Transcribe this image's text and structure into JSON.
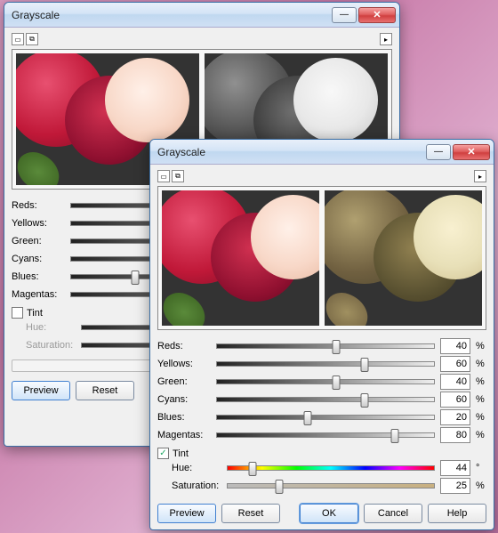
{
  "windows": {
    "back": {
      "title": "Grayscale",
      "sliders": {
        "reds": {
          "label": "Reds:"
        },
        "yellows": {
          "label": "Yellows:"
        },
        "green": {
          "label": "Green:"
        },
        "cyans": {
          "label": "Cyans:"
        },
        "blues": {
          "label": "Blues:"
        },
        "magentas": {
          "label": "Magentas:"
        }
      },
      "tint": {
        "label": "Tint",
        "checked": false,
        "hue": {
          "label": "Hue:"
        },
        "sat": {
          "label": "Saturation:"
        }
      },
      "buttons": {
        "preview": "Preview",
        "reset": "Reset"
      }
    },
    "front": {
      "title": "Grayscale",
      "sliders": {
        "reds": {
          "label": "Reds:",
          "value": 40,
          "unit": "%"
        },
        "yellows": {
          "label": "Yellows:",
          "value": 60,
          "unit": "%"
        },
        "green": {
          "label": "Green:",
          "value": 40,
          "unit": "%"
        },
        "cyans": {
          "label": "Cyans:",
          "value": 60,
          "unit": "%"
        },
        "blues": {
          "label": "Blues:",
          "value": 20,
          "unit": "%"
        },
        "magentas": {
          "label": "Magentas:",
          "value": 80,
          "unit": "%"
        }
      },
      "tint": {
        "label": "Tint",
        "checked": true,
        "hue": {
          "label": "Hue:",
          "value": 44,
          "unit": "°"
        },
        "sat": {
          "label": "Saturation:",
          "value": 25,
          "unit": "%"
        }
      },
      "buttons": {
        "preview": "Preview",
        "reset": "Reset",
        "ok": "OK",
        "cancel": "Cancel",
        "help": "Help"
      }
    }
  }
}
